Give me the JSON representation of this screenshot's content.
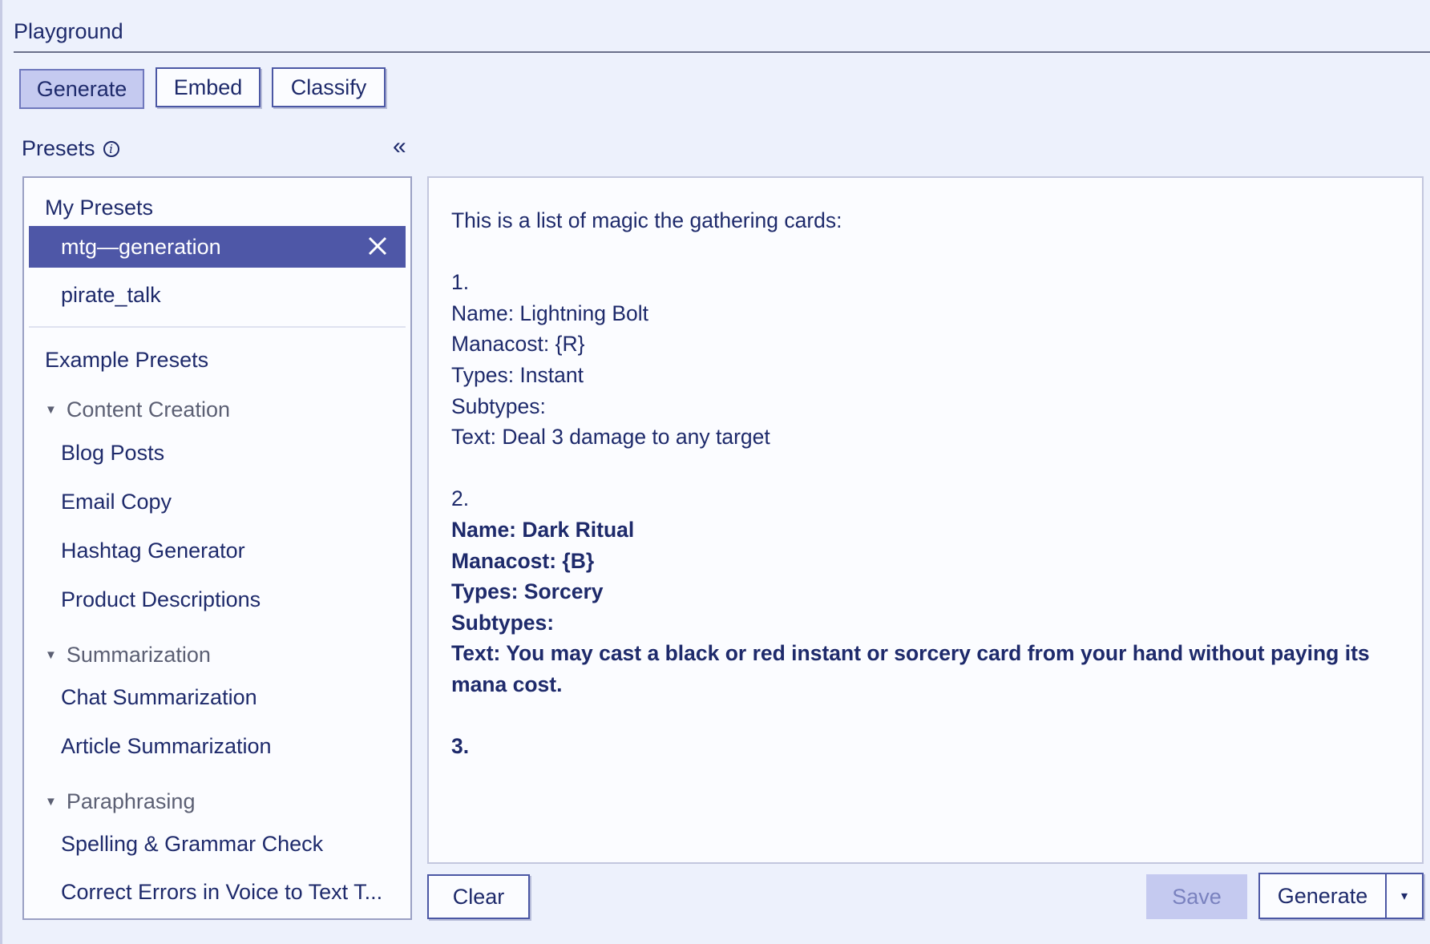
{
  "app": {
    "title": "Playground"
  },
  "tabs": [
    {
      "label": "Generate",
      "active": true
    },
    {
      "label": "Embed",
      "active": false
    },
    {
      "label": "Classify",
      "active": false
    }
  ],
  "presets": {
    "label": "Presets",
    "info_icon": "info-icon",
    "collapse_icon": "«",
    "my_presets": {
      "title": "My Presets",
      "items": [
        {
          "label": "mtg—generation",
          "selected": true
        },
        {
          "label": "pirate_talk",
          "selected": false
        }
      ]
    },
    "example_presets": {
      "title": "Example Presets",
      "groups": [
        {
          "label": "Content Creation",
          "items": [
            "Blog Posts",
            "Email Copy",
            "Hashtag Generator",
            "Product Descriptions"
          ]
        },
        {
          "label": "Summarization",
          "items": [
            "Chat Summarization",
            "Article Summarization"
          ]
        },
        {
          "label": "Paraphrasing",
          "items": [
            "Spelling & Grammar Check",
            "Correct Errors in Voice to Text T..."
          ]
        }
      ]
    }
  },
  "editor": {
    "lines": [
      {
        "text": "This is a list of magic the gathering cards:",
        "bold": false
      },
      {
        "text": "",
        "bold": false
      },
      {
        "text": "1.",
        "bold": false
      },
      {
        "text": "Name: Lightning Bolt",
        "bold": false
      },
      {
        "text": "Manacost: {R}",
        "bold": false
      },
      {
        "text": "Types: Instant",
        "bold": false
      },
      {
        "text": "Subtypes:",
        "bold": false
      },
      {
        "text": "Text: Deal 3 damage to any target",
        "bold": false
      },
      {
        "text": "",
        "bold": false
      },
      {
        "text": "2.",
        "bold": false
      },
      {
        "text": "Name: Dark Ritual",
        "bold": true
      },
      {
        "text": "Manacost: {B}",
        "bold": true
      },
      {
        "text": "Types: Sorcery",
        "bold": true
      },
      {
        "text": "Subtypes:",
        "bold": true
      },
      {
        "text": "Text: You may cast a black or red instant or sorcery card from your hand without paying its mana cost.",
        "bold": true
      },
      {
        "text": "",
        "bold": false
      },
      {
        "text": "3.",
        "bold": true
      }
    ]
  },
  "actions": {
    "clear_label": "Clear",
    "save_label": "Save",
    "generate_label": "Generate",
    "dropdown_icon": "▾"
  },
  "colors": {
    "background": "#edf1fc",
    "accent": "#4e57a7",
    "active_tab": "#c5caf0",
    "text": "#1e2a6b"
  }
}
